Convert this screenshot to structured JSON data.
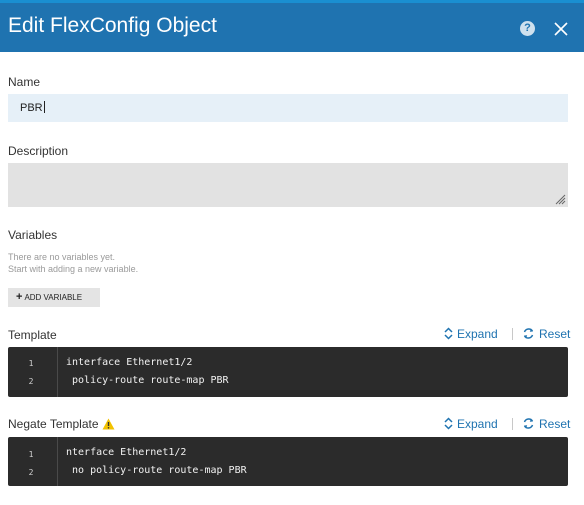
{
  "dialog": {
    "title": "Edit FlexConfig Object",
    "help_glyph": "?",
    "header_color": "#1f73b0",
    "accent_color": "#1f73b0"
  },
  "name": {
    "label": "Name",
    "value": "PBR"
  },
  "description": {
    "label": "Description",
    "value": ""
  },
  "variables": {
    "label": "Variables",
    "empty_line1": "There are no variables yet.",
    "empty_line2": "Start with adding a new variable.",
    "add_button": "ADD VARIABLE"
  },
  "template": {
    "label": "Template",
    "expand": "Expand",
    "reset": "Reset",
    "lines": [
      {
        "num": "1",
        "text": "interface Ethernet1/2"
      },
      {
        "num": "2",
        "text": " policy-route route-map PBR"
      }
    ]
  },
  "negate_template": {
    "label": "Negate Template",
    "warning_icon": "warning-icon",
    "expand": "Expand",
    "reset": "Reset",
    "lines": [
      {
        "num": "1",
        "text": "nterface Ethernet1/2"
      },
      {
        "num": "2",
        "text": " no policy-route route-map PBR"
      }
    ]
  }
}
